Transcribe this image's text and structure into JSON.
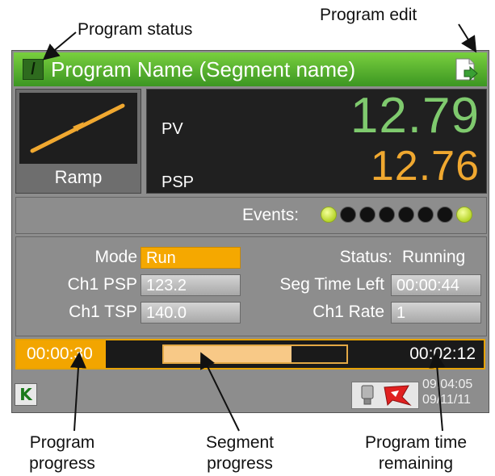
{
  "callouts": {
    "program_status": "Program status",
    "program_edit": "Program edit",
    "program_progress": [
      "Program",
      "progress"
    ],
    "segment_progress": [
      "Segment",
      "progress"
    ],
    "program_time_remaining": [
      "Program time",
      "remaining"
    ]
  },
  "title_bar": {
    "status_glyph": "/",
    "title": "Program Name (Segment name)",
    "edit_icon": "program-edit-icon",
    "color": "#5bb033"
  },
  "segment_type": {
    "label": "Ramp",
    "icon": "ramp-icon"
  },
  "values": {
    "pv_label": "PV",
    "pv": "12.79",
    "psp_label": "PSP",
    "psp": "12.76",
    "pv_color": "#7fca6e",
    "psp_color": "#f0a830"
  },
  "events": {
    "label": "Events:",
    "states": [
      true,
      false,
      false,
      false,
      false,
      false,
      false,
      true
    ]
  },
  "params": {
    "mode_label": "Mode",
    "mode_value": "Run",
    "ch1_psp_label": "Ch1 PSP",
    "ch1_psp_value": "123.2",
    "ch1_tsp_label": "Ch1 TSP",
    "ch1_tsp_value": "140.0",
    "status_label": "Status:",
    "status_value": "Running",
    "seg_time_left_label": "Seg Time Left",
    "seg_time_left_value": "00:00:44",
    "ch1_rate_label": "Ch1 Rate",
    "ch1_rate_value": "1"
  },
  "progress": {
    "elapsed": "00:00:30",
    "remaining": "00:02:12",
    "program_progress": 0.19,
    "segment_progress": 0.7
  },
  "bottom_bar": {
    "logo": "K",
    "time": "09:04:05",
    "date": "09/11/11",
    "tray_icons": [
      "usb-icon",
      "alarm-bell-icon"
    ]
  }
}
